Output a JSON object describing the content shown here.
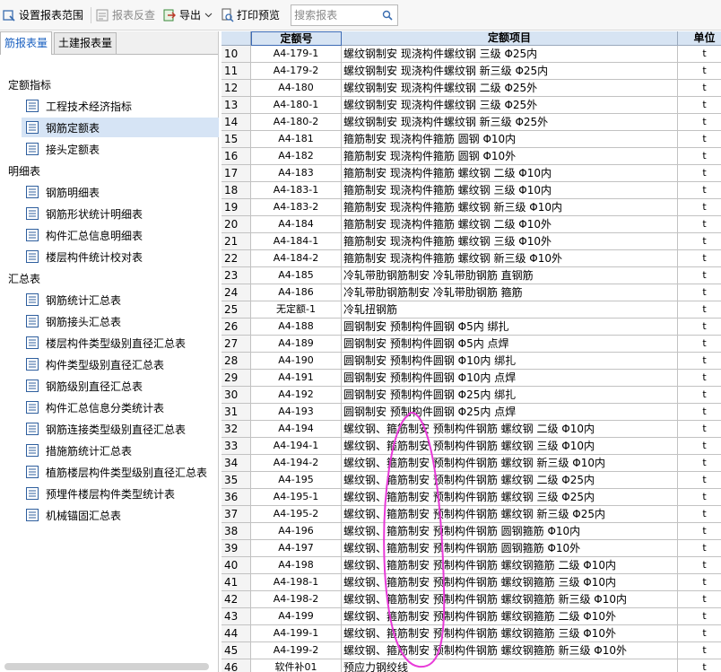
{
  "toolbar": {
    "set_range": "设置报表范围",
    "report_check": "报表反查",
    "export": "导出",
    "print_preview": "打印预览",
    "search_placeholder": "搜索报表"
  },
  "left": {
    "tabs": [
      "筋报表量",
      "土建报表量"
    ],
    "groups": [
      {
        "title": "定额指标",
        "items": [
          "工程技术经济指标",
          "钢筋定额表",
          "接头定额表"
        ]
      },
      {
        "title": "明细表",
        "items": [
          "钢筋明细表",
          "钢筋形状统计明细表",
          "构件汇总信息明细表",
          "楼层构件统计校对表"
        ]
      },
      {
        "title": "汇总表",
        "items": [
          "钢筋统计汇总表",
          "钢筋接头汇总表",
          "楼层构件类型级别直径汇总表",
          "构件类型级别直径汇总表",
          "钢筋级别直径汇总表",
          "构件汇总信息分类统计表",
          "钢筋连接类型级别直径汇总表",
          "措施筋统计汇总表",
          "植筋楼层构件类型级别直径汇总表",
          "预埋件楼层构件类型统计表",
          "机械锚固汇总表"
        ]
      }
    ],
    "selected_item": "钢筋定额表"
  },
  "grid": {
    "headers": [
      "定额号",
      "定额项目",
      "单位"
    ],
    "rows": [
      {
        "n": "10",
        "code": "A4-179-1",
        "item": "螺纹钢制安 现浇构件螺纹钢 三级 Φ25内",
        "unit": "t"
      },
      {
        "n": "11",
        "code": "A4-179-2",
        "item": "螺纹钢制安 现浇构件螺纹钢 新三级 Φ25内",
        "unit": "t"
      },
      {
        "n": "12",
        "code": "A4-180",
        "item": "螺纹钢制安 现浇构件螺纹钢 二级 Φ25外",
        "unit": "t"
      },
      {
        "n": "13",
        "code": "A4-180-1",
        "item": "螺纹钢制安 现浇构件螺纹钢 三级 Φ25外",
        "unit": "t"
      },
      {
        "n": "14",
        "code": "A4-180-2",
        "item": "螺纹钢制安 现浇构件螺纹钢 新三级 Φ25外",
        "unit": "t"
      },
      {
        "n": "15",
        "code": "A4-181",
        "item": "箍筋制安 现浇构件箍筋 圆钢 Φ10内",
        "unit": "t"
      },
      {
        "n": "16",
        "code": "A4-182",
        "item": "箍筋制安 现浇构件箍筋 圆钢 Φ10外",
        "unit": "t"
      },
      {
        "n": "17",
        "code": "A4-183",
        "item": "箍筋制安 现浇构件箍筋 螺纹钢 二级 Φ10内",
        "unit": "t"
      },
      {
        "n": "18",
        "code": "A4-183-1",
        "item": "箍筋制安 现浇构件箍筋 螺纹钢  三级 Φ10内",
        "unit": "t"
      },
      {
        "n": "19",
        "code": "A4-183-2",
        "item": "箍筋制安 现浇构件箍筋 螺纹钢  新三级 Φ10内",
        "unit": "t"
      },
      {
        "n": "20",
        "code": "A4-184",
        "item": "箍筋制安 现浇构件箍筋 螺纹钢 二级 Φ10外",
        "unit": "t"
      },
      {
        "n": "21",
        "code": "A4-184-1",
        "item": "箍筋制安 现浇构件箍筋 螺纹钢 三级 Φ10外",
        "unit": "t"
      },
      {
        "n": "22",
        "code": "A4-184-2",
        "item": "箍筋制安 现浇构件箍筋 螺纹钢 新三级 Φ10外",
        "unit": "t"
      },
      {
        "n": "23",
        "code": "A4-185",
        "item": "冷轧带肋钢筋制安 冷轧带肋钢筋 直钢筋",
        "unit": "t"
      },
      {
        "n": "24",
        "code": "A4-186",
        "item": "冷轧带肋钢筋制安 冷轧带肋钢筋 箍筋",
        "unit": "t"
      },
      {
        "n": "25",
        "code": "无定额-1",
        "item": "冷轧扭钢筋",
        "unit": "t"
      },
      {
        "n": "26",
        "code": "A4-188",
        "item": "圆钢制安 预制构件圆钢 Φ5内 绑扎",
        "unit": "t"
      },
      {
        "n": "27",
        "code": "A4-189",
        "item": "圆钢制安 预制构件圆钢 Φ5内 点焊",
        "unit": "t"
      },
      {
        "n": "28",
        "code": "A4-190",
        "item": "圆钢制安 预制构件圆钢 Φ10内 绑扎",
        "unit": "t"
      },
      {
        "n": "29",
        "code": "A4-191",
        "item": "圆钢制安 预制构件圆钢 Φ10内 点焊",
        "unit": "t"
      },
      {
        "n": "30",
        "code": "A4-192",
        "item": "圆钢制安 预制构件圆钢 Φ25内 绑扎",
        "unit": "t"
      },
      {
        "n": "31",
        "code": "A4-193",
        "item": "圆钢制安 预制构件圆钢 Φ25内 点焊",
        "unit": "t"
      },
      {
        "n": "32",
        "code": "A4-194",
        "item": "螺纹钢、箍筋制安 预制构件钢筋 螺纹钢 二级 Φ10内",
        "unit": "t"
      },
      {
        "n": "33",
        "code": "A4-194-1",
        "item": "螺纹钢、箍筋制安 预制构件钢筋 螺纹钢 三级 Φ10内",
        "unit": "t"
      },
      {
        "n": "34",
        "code": "A4-194-2",
        "item": "螺纹钢、箍筋制安 预制构件钢筋 螺纹钢 新三级 Φ10内",
        "unit": "t"
      },
      {
        "n": "35",
        "code": "A4-195",
        "item": "螺纹钢、箍筋制安 预制构件钢筋 螺纹钢 二级 Φ25内",
        "unit": "t"
      },
      {
        "n": "36",
        "code": "A4-195-1",
        "item": "螺纹钢、箍筋制安 预制构件钢筋 螺纹钢 三级 Φ25内",
        "unit": "t"
      },
      {
        "n": "37",
        "code": "A4-195-2",
        "item": "螺纹钢、箍筋制安 预制构件钢筋 螺纹钢 新三级 Φ25内",
        "unit": "t"
      },
      {
        "n": "38",
        "code": "A4-196",
        "item": "螺纹钢、箍筋制安 预制构件钢筋 圆钢箍筋 Φ10内",
        "unit": "t"
      },
      {
        "n": "39",
        "code": "A4-197",
        "item": "螺纹钢、箍筋制安 预制构件钢筋 圆钢箍筋 Φ10外",
        "unit": "t"
      },
      {
        "n": "40",
        "code": "A4-198",
        "item": "螺纹钢、箍筋制安 预制构件钢筋 螺纹钢箍筋 二级 Φ10内",
        "unit": "t"
      },
      {
        "n": "41",
        "code": "A4-198-1",
        "item": "螺纹钢、箍筋制安 预制构件钢筋 螺纹钢箍筋 三级 Φ10内",
        "unit": "t"
      },
      {
        "n": "42",
        "code": "A4-198-2",
        "item": "螺纹钢、箍筋制安 预制构件钢筋 螺纹钢箍筋 新三级 Φ10内",
        "unit": "t"
      },
      {
        "n": "43",
        "code": "A4-199",
        "item": "螺纹钢、箍筋制安 预制构件钢筋 螺纹钢箍筋 二级 Φ10外",
        "unit": "t"
      },
      {
        "n": "44",
        "code": "A4-199-1",
        "item": "螺纹钢、箍筋制安 预制构件钢筋 螺纹钢箍筋 三级 Φ10外",
        "unit": "t"
      },
      {
        "n": "45",
        "code": "A4-199-2",
        "item": "螺纹钢、箍筋制安 预制构件钢筋 螺纹钢箍筋 新三级 Φ10外",
        "unit": "t"
      },
      {
        "n": "46",
        "code": "软件补01",
        "item": "预应力钢绞线",
        "unit": "t"
      }
    ]
  },
  "icons": {
    "set_range": "range-icon",
    "report_check": "report-check-icon",
    "export": "export-icon",
    "print_preview": "print-preview-icon",
    "search": "search-icon",
    "report_doc": "report-doc-icon"
  },
  "colors": {
    "accent": "#1a60c0",
    "header_bg": "#d7e4f3",
    "selection": "#d6e4f5",
    "annotation": "#e83ad8"
  }
}
